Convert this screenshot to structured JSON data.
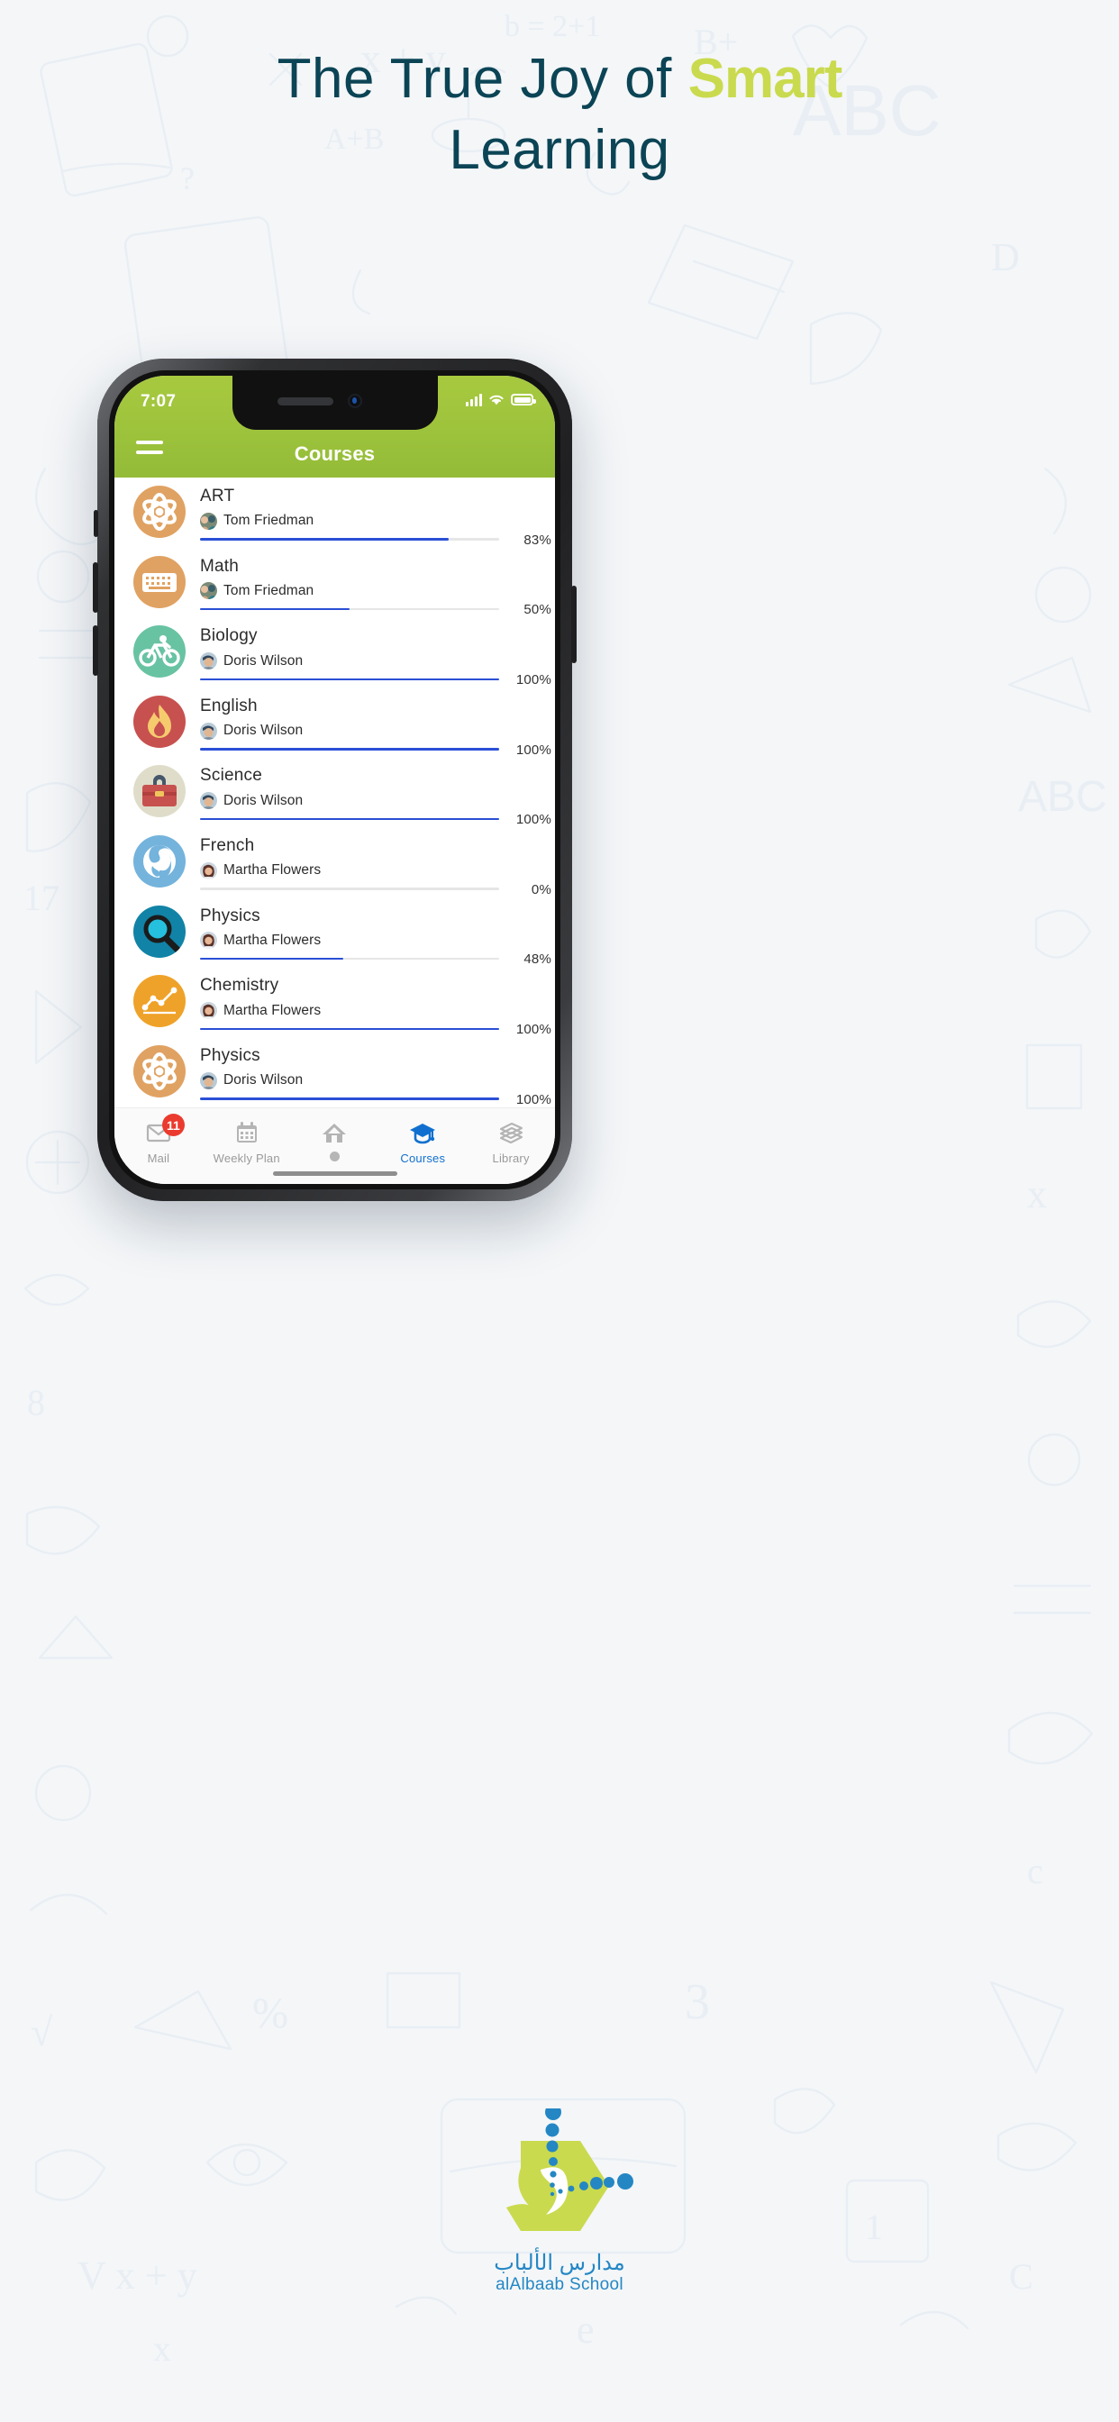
{
  "hero": {
    "line1_pre": "The True Joy of ",
    "line1_accent": "Smart",
    "line2": "Learning",
    "accent_color": "#cada4e",
    "text_color": "#0b4455"
  },
  "phone": {
    "status": {
      "time": "7:07",
      "signal_icon": "cellular-signal-icon",
      "wifi_icon": "wifi-icon",
      "battery_icon": "battery-full-icon"
    },
    "header": {
      "menu_icon": "hamburger-menu-icon",
      "title": "Courses",
      "background_color": "#9dc33c"
    },
    "courses": [
      {
        "title": "ART",
        "teacher": "Tom Friedman",
        "progress": 83,
        "percent_label": "83%",
        "icon": "atom-icon",
        "icon_bg": "#e0a262",
        "avatar": "avatar-tom-friedman"
      },
      {
        "title": "Math",
        "teacher": "Tom Friedman",
        "progress": 50,
        "percent_label": "50%",
        "icon": "keyboard-icon",
        "icon_bg": "#e0a262",
        "avatar": "avatar-tom-friedman"
      },
      {
        "title": "Biology",
        "teacher": "Doris Wilson",
        "progress": 100,
        "percent_label": "100%",
        "icon": "bicycle-icon",
        "icon_bg": "#68c3a3",
        "avatar": "avatar-doris-wilson"
      },
      {
        "title": "English",
        "teacher": "Doris Wilson",
        "progress": 100,
        "percent_label": "100%",
        "icon": "flame-icon",
        "icon_bg": "#c7514f",
        "avatar": "avatar-doris-wilson"
      },
      {
        "title": "Science",
        "teacher": "Doris Wilson",
        "progress": 100,
        "percent_label": "100%",
        "icon": "briefcase-icon",
        "icon_bg": "#dfddca",
        "avatar": "avatar-doris-wilson"
      },
      {
        "title": "French",
        "teacher": "Martha Flowers",
        "progress": 0,
        "percent_label": "0%",
        "icon": "globe-icon",
        "icon_bg": "#74b3dc",
        "avatar": "avatar-martha-flowers"
      },
      {
        "title": "Physics",
        "teacher": "Martha Flowers",
        "progress": 48,
        "percent_label": "48%",
        "icon": "magnifier-icon",
        "icon_bg": "#1183a6",
        "avatar": "avatar-martha-flowers"
      },
      {
        "title": "Chemistry",
        "teacher": "Martha Flowers",
        "progress": 100,
        "percent_label": "100%",
        "icon": "line-chart-icon",
        "icon_bg": "#efa229",
        "avatar": "avatar-martha-flowers"
      },
      {
        "title": "Physics",
        "teacher": "Doris Wilson",
        "progress": 100,
        "percent_label": "100%",
        "icon": "atom-icon",
        "icon_bg": "#e0a262",
        "avatar": "avatar-doris-wilson"
      }
    ],
    "progress_fill_color": "#2a4fd6",
    "bottom_nav": {
      "active_color": "#1170cf",
      "items": [
        {
          "label": "Mail",
          "icon": "mail-icon",
          "badge": "11",
          "active": false
        },
        {
          "label": "Weekly Plan",
          "icon": "calendar-icon",
          "badge": "",
          "active": false
        },
        {
          "label": "",
          "icon": "home-icon",
          "badge": "",
          "active": false
        },
        {
          "label": "Courses",
          "icon": "graduation-cap-icon",
          "badge": "",
          "active": true
        },
        {
          "label": "Library",
          "icon": "books-icon",
          "badge": "",
          "active": false
        }
      ]
    }
  },
  "footer": {
    "logo_icon": "alalbaab-hexagon-logo",
    "arabic_name": "مدارس الألباب",
    "english_name": "alAlbaab School",
    "brand_color": "#2487c4",
    "hex_color": "#cada4e"
  }
}
